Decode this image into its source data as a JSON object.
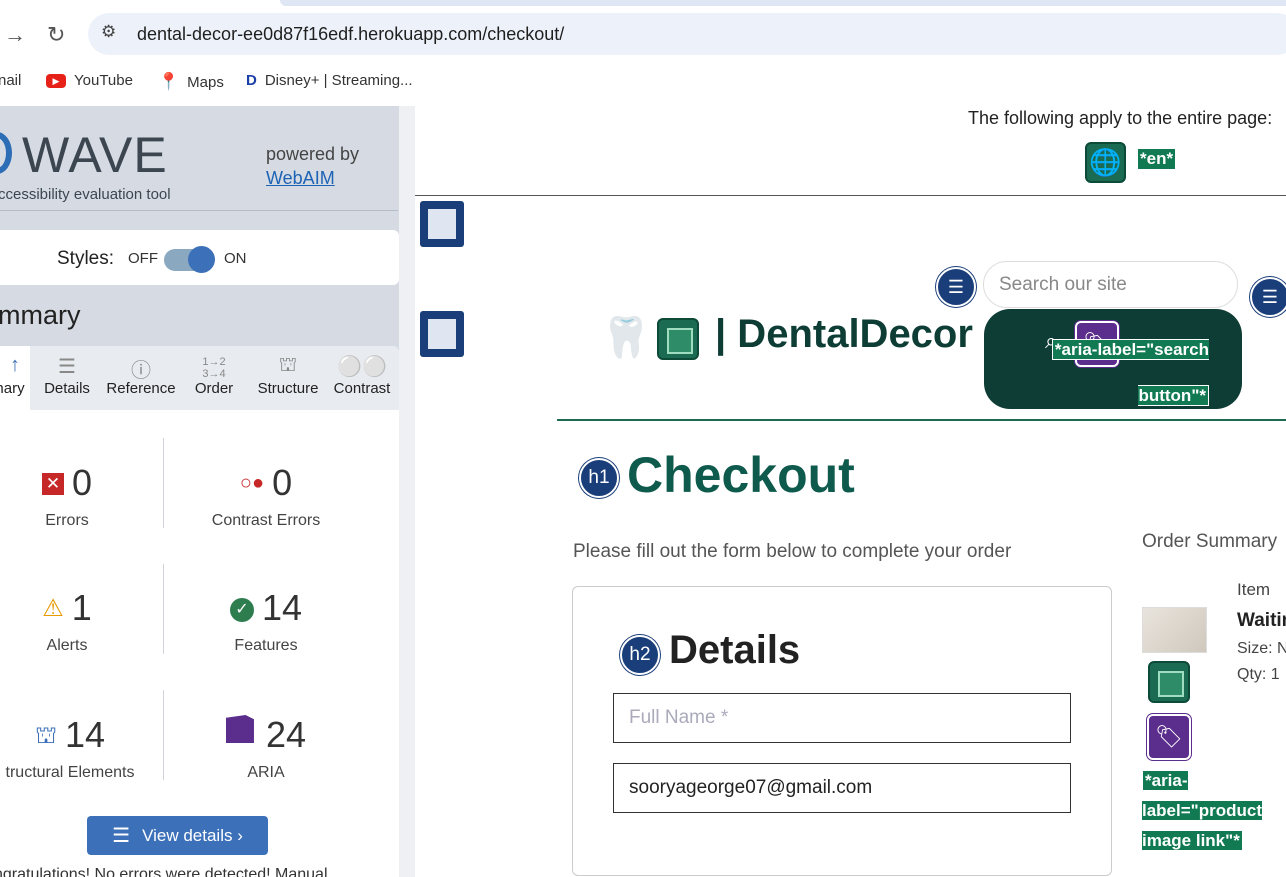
{
  "browser": {
    "url": "dental-decor-ee0d87f16edf.herokuapp.com/checkout/",
    "bookmarks": [
      {
        "label": "nail",
        "icon": "gmail-icon"
      },
      {
        "label": "YouTube",
        "icon": "youtube-icon"
      },
      {
        "label": "Maps",
        "icon": "maps-icon"
      },
      {
        "label": "Disney+ | Streaming...",
        "icon": "disney-icon"
      }
    ]
  },
  "wave": {
    "logo": "WAVE",
    "subtitle": "ccessibility evaluation tool",
    "powered_by": "powered by",
    "webaim": "WebAIM",
    "styles_label": "Styles:",
    "styles_off": "OFF",
    "styles_on": "ON",
    "styles_state": "on",
    "summary_title": "mmary",
    "tabs": [
      {
        "label": "nary",
        "icon": "summary-icon",
        "active": true
      },
      {
        "label": "Details",
        "icon": "details-icon"
      },
      {
        "label": "Reference",
        "icon": "reference-icon"
      },
      {
        "label": "Order",
        "icon": "order-icon"
      },
      {
        "label": "Structure",
        "icon": "structure-icon"
      },
      {
        "label": "Contrast",
        "icon": "contrast-icon"
      }
    ],
    "stats": {
      "errors": {
        "value": "0",
        "label": "Errors",
        "color": "#c62828"
      },
      "contrast_errors": {
        "value": "0",
        "label": "Contrast Errors",
        "color": "#c62828"
      },
      "alerts": {
        "value": "1",
        "label": "Alerts",
        "color": "#e69a00"
      },
      "features": {
        "value": "14",
        "label": "Features",
        "color": "#2e7d4f"
      },
      "structural": {
        "value": "14",
        "label": "tructural Elements",
        "color": "#3c70b9"
      },
      "aria": {
        "value": "24",
        "label": "ARIA",
        "color": "#5b2d8c"
      }
    },
    "view_details": "View details ›",
    "congrats": "ngratulations! No errors were detected! Manual"
  },
  "page": {
    "entire_page_note": "The following apply to the entire page:",
    "lang_label": "*en*",
    "search_placeholder": "Search our site",
    "search_aria_label": "*aria-label=\"search button\"*",
    "brand": "| DentalDecor",
    "checkout_badge": "h1",
    "checkout_title": "Checkout",
    "instructions": "Please fill out the form below to complete your order",
    "details_badge": "h2",
    "details_title": "Details",
    "fullname_placeholder": "Full Name *",
    "email_value": "sooryageorge07@gmail.com",
    "order_summary": "Order Summary",
    "item_header": "Item",
    "product_name": "Waitin",
    "product_size": "Size: N",
    "product_qty": "Qty: 1",
    "product_aria_label": "*aria-label=\"product image link\"*"
  }
}
